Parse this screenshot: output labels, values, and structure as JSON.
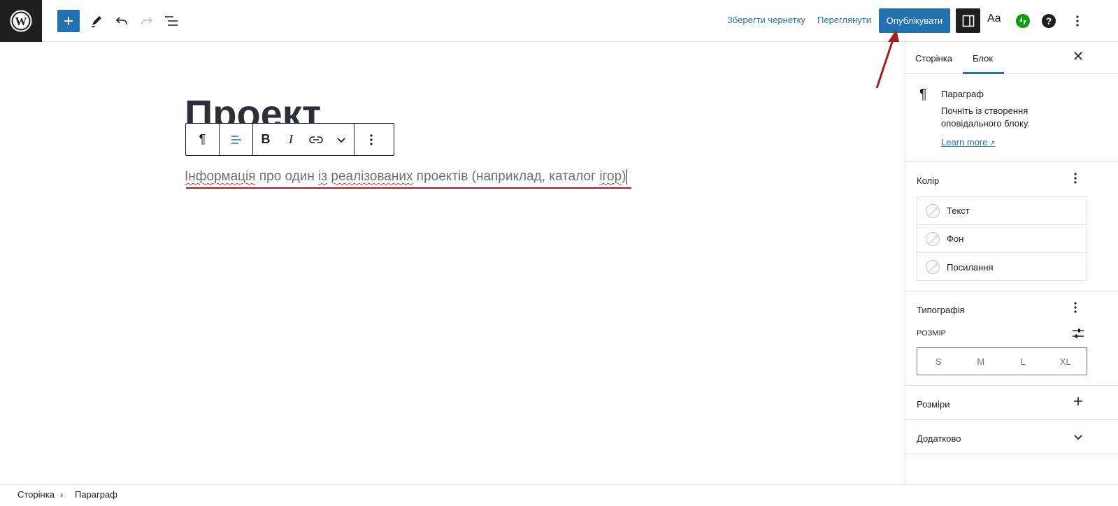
{
  "header": {
    "save_draft": "Зберегти чернетку",
    "preview": "Переглянути",
    "publish": "Опублікувати",
    "styles_label": "Aa"
  },
  "editor": {
    "post_title": "Проект",
    "paragraph": {
      "part1": "Інформація",
      "part2": " про один ",
      "part3": "із",
      "part4": " ",
      "part5": "реалізованих",
      "part6": " проектів (наприклад, каталог ",
      "part7": "ігор",
      "part8": ")"
    }
  },
  "sidebar": {
    "tabs": [
      "Сторінка",
      "Блок"
    ],
    "active_tab": "Блок",
    "block_card": {
      "icon": "¶",
      "name": "Параграф",
      "description": "Почніть із створення оповідального блоку.",
      "learn_more": "Learn more"
    },
    "color_panel": {
      "title": "Колір",
      "items": [
        "Текст",
        "Фон",
        "Посилання"
      ]
    },
    "typography_panel": {
      "title": "Типографія",
      "size_label": "РОЗМІР",
      "sizes": [
        "S",
        "M",
        "L",
        "XL"
      ]
    },
    "dimensions_panel": {
      "title": "Розміри"
    },
    "advanced_panel": {
      "title": "Додатково"
    }
  },
  "footer": {
    "breadcrumb": [
      "Сторінка",
      "Параграф"
    ]
  },
  "colors": {
    "accent": "#2271b1",
    "dark": "#1e1e1e",
    "annotation_arrow": "#a51e1e"
  }
}
